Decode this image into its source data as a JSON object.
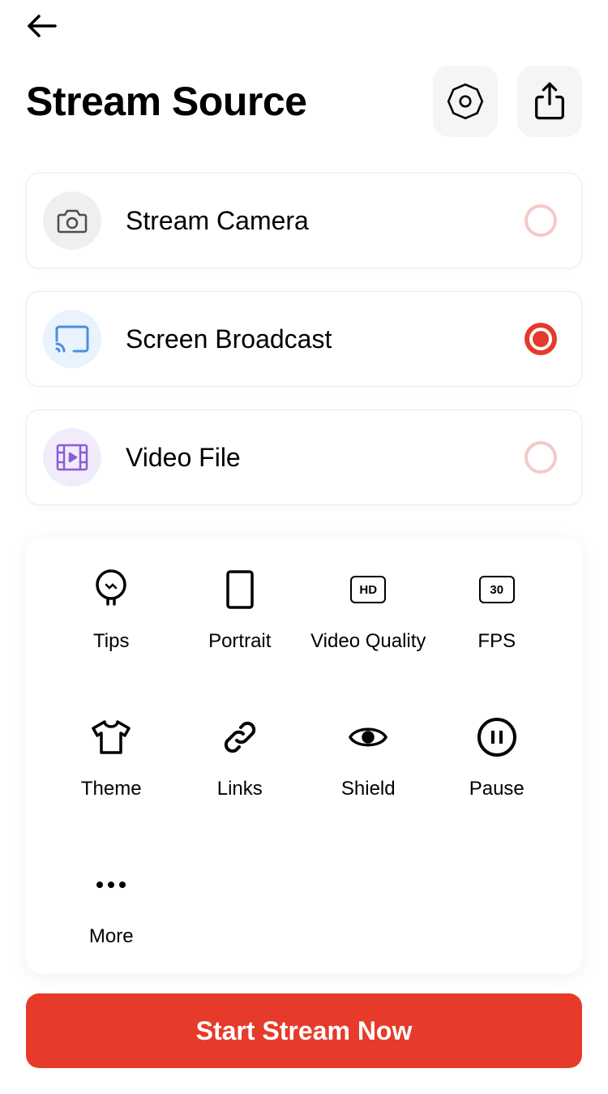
{
  "title": "Stream Source",
  "sources": [
    {
      "label": "Stream Camera",
      "selected": false
    },
    {
      "label": "Screen Broadcast",
      "selected": true
    },
    {
      "label": "Video File",
      "selected": false
    }
  ],
  "tools": {
    "tips": "Tips",
    "portrait": "Portrait",
    "videoQuality": {
      "label": "Video Quality",
      "badge": "HD"
    },
    "fps": {
      "label": "FPS",
      "badge": "30"
    },
    "theme": "Theme",
    "links": "Links",
    "shield": "Shield",
    "pause": "Pause",
    "more": "More"
  },
  "cta": "Start Stream Now"
}
